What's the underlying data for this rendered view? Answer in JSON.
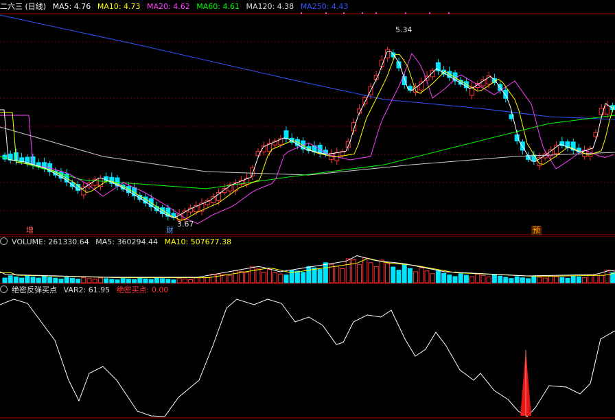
{
  "main": {
    "title": "二六三 (日线)",
    "ma": [
      {
        "label": "MA5: 4.76",
        "color": "#ffffff"
      },
      {
        "label": "MA10: 4.73",
        "color": "#ffff00"
      },
      {
        "label": "MA20: 4.62",
        "color": "#ff40ff"
      },
      {
        "label": "MA60: 4.61",
        "color": "#00ff00"
      },
      {
        "label": "MA120: 4.38",
        "color": "#dddddd"
      },
      {
        "label": "MA250: 4.43",
        "color": "#3355ff"
      }
    ],
    "high_label": "5.34",
    "low_label": "3.67",
    "tag_left": "增",
    "tag_mid": "财",
    "tag_right": "预"
  },
  "volume": {
    "label": "VOLUME: 261330.64",
    "ma5": "MA5: 360294.44",
    "ma10": "MA10: 507677.38"
  },
  "indicator": {
    "name": "绝密反弹买点",
    "var2": "VAR2: 61.95",
    "buy": "绝密买点: 0.00"
  },
  "colors": {
    "up": "#ff3333",
    "down": "#00e5ff",
    "grid": "#7a0000",
    "white": "#ffffff",
    "yellow": "#ffff00",
    "magenta": "#ff40ff",
    "green": "#00ff00",
    "blue": "#3355ff",
    "signal": "#ff1a1a"
  }
}
